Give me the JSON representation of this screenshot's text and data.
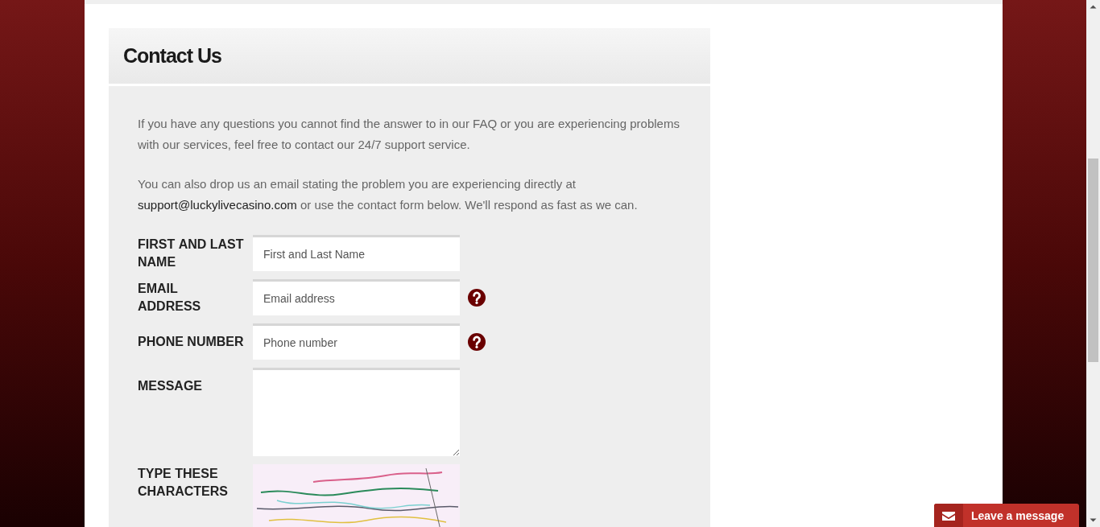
{
  "card": {
    "title": "Contact Us"
  },
  "intro": "If you have any questions you cannot find the answer to in our FAQ or you are experiencing problems with our services, feel free to contact our 24/7 support service.",
  "email_note": {
    "before": "You can also drop us an email stating the problem you are experiencing directly at",
    "link": "support@luckylivecasino.com",
    "after": "or use the contact form below. We'll respond as fast as we can."
  },
  "form": {
    "fields": [
      {
        "kind": "input",
        "label": "FIRST AND LAST NAME",
        "placeholder": "First and Last Name",
        "help_icon": false
      },
      {
        "kind": "input",
        "label": "EMAIL ADDRESS",
        "placeholder": "Email address",
        "help_icon": true
      },
      {
        "kind": "input",
        "label": "PHONE NUMBER",
        "placeholder": "Phone number",
        "help_icon": true
      },
      {
        "kind": "textarea",
        "label": "MESSAGE",
        "help_icon": false
      },
      {
        "kind": "captcha",
        "label": "TYPE THESE CHARACTERS",
        "help_icon": false
      }
    ]
  },
  "chat_button": {
    "label": "Leave a message"
  }
}
